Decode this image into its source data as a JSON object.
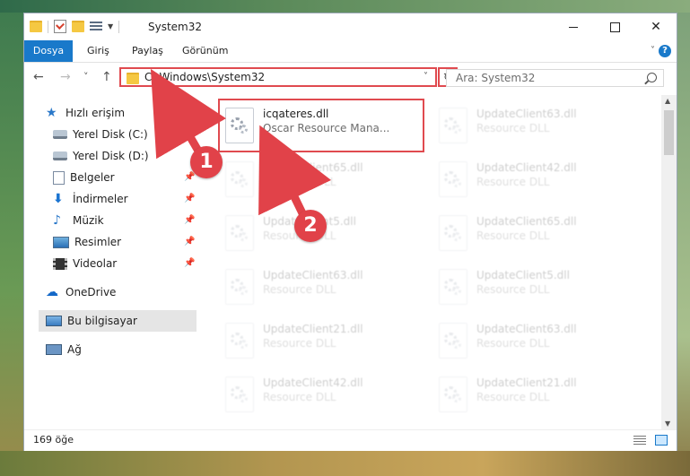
{
  "window": {
    "title": "System32",
    "controls": {
      "minimize": "—",
      "maximize": "☐",
      "close": "✕"
    }
  },
  "ribbon": {
    "tabs": [
      "Dosya",
      "Giriş",
      "Paylaş",
      "Görünüm"
    ],
    "help": "?"
  },
  "navbar": {
    "back": "←",
    "forward": "→",
    "recent": "˅",
    "up": "↑",
    "address": "C:\\Windows\\System32",
    "refresh": "↻",
    "search_placeholder": "Ara: System32"
  },
  "sidebar": {
    "items": [
      {
        "label": "Hızlı erişim",
        "icon": "star-icon"
      },
      {
        "label": "Yerel Disk (C:)",
        "icon": "drive-icon",
        "pinned": true
      },
      {
        "label": "Yerel Disk (D:)",
        "icon": "drive-icon",
        "pinned": true
      },
      {
        "label": "Belgeler",
        "icon": "document-icon",
        "pinned": true
      },
      {
        "label": "İndirmeler",
        "icon": "download-icon",
        "pinned": true
      },
      {
        "label": "Müzik",
        "icon": "music-icon",
        "pinned": true
      },
      {
        "label": "Resimler",
        "icon": "pictures-icon",
        "pinned": true
      },
      {
        "label": "Videolar",
        "icon": "videos-icon",
        "pinned": true
      },
      {
        "label": "OneDrive",
        "icon": "cloud-icon"
      },
      {
        "label": "Bu bilgisayar",
        "icon": "computer-icon",
        "selected": true
      },
      {
        "label": "Ağ",
        "icon": "network-icon"
      }
    ]
  },
  "files": [
    {
      "name": "icqateres.dll",
      "type": "Oscar Resource Mana...",
      "highlighted": true
    },
    {
      "name": "UpdateClient63.dll",
      "type": "Resource DLL"
    },
    {
      "name": "UpdateClient65.dll",
      "type": "Resource DLL"
    },
    {
      "name": "UpdateClient42.dll",
      "type": "Resource DLL"
    },
    {
      "name": "UpdateClient5.dll",
      "type": "Resource DLL"
    },
    {
      "name": "UpdateClient65.dll",
      "type": "Resource DLL"
    },
    {
      "name": "UpdateClient63.dll",
      "type": "Resource DLL"
    },
    {
      "name": "UpdateClient5.dll",
      "type": "Resource DLL"
    },
    {
      "name": "UpdateClient21.dll",
      "type": "Resource DLL"
    },
    {
      "name": "UpdateClient63.dll",
      "type": "Resource DLL"
    },
    {
      "name": "UpdateClient42.dll",
      "type": "Resource DLL"
    },
    {
      "name": "UpdateClient21.dll",
      "type": "Resource DLL"
    }
  ],
  "status": {
    "count": "169 öğe"
  },
  "annotations": {
    "step1": "1",
    "step2": "2",
    "color": "#e14249"
  }
}
